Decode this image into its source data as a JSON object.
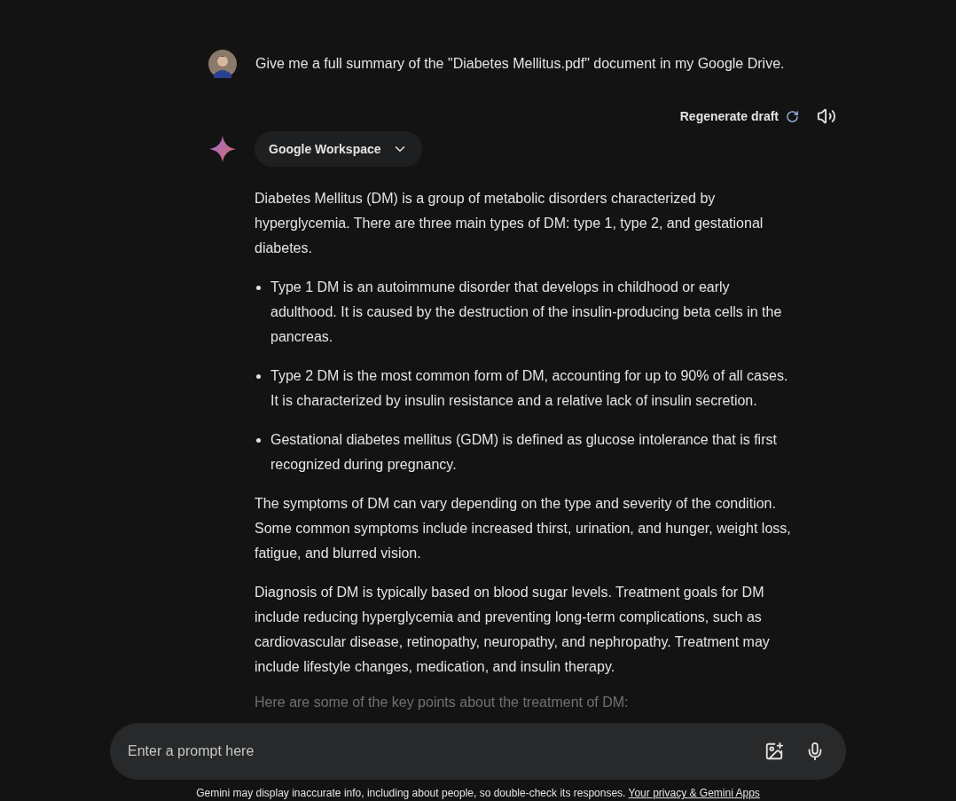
{
  "user_prompt": "Give me a full summary of the \"Diabetes Mellitus.pdf\" document in my Google Drive.",
  "regenerate_label": "Regenerate draft",
  "source_chip": "Google Workspace",
  "response": [
    {
      "kind": "paragraph",
      "text": "Diabetes Mellitus (DM) is a group of metabolic disorders characterized by hyperglycemia. There are three main types of DM: type 1, type 2, and gestational diabetes."
    },
    {
      "kind": "bullets",
      "items": [
        "Type 1 DM is an autoimmune disorder that develops in childhood or early adulthood. It is caused by the destruction of the insulin-producing beta cells in the pancreas.",
        "Type 2 DM is the most common form of DM, accounting for up to 90% of all cases. It is characterized by insulin resistance and a relative lack of insulin secretion.",
        "Gestational diabetes mellitus (GDM) is defined as glucose intolerance that is first recognized during pregnancy."
      ]
    },
    {
      "kind": "paragraph",
      "text": "The symptoms of DM can vary depending on the type and severity of the condition. Some common symptoms include increased thirst, urination, and hunger, weight loss, fatigue, and blurred vision."
    },
    {
      "kind": "paragraph",
      "text": "Diagnosis of DM is typically based on blood sugar levels. Treatment goals for DM include reducing hyperglycemia and preventing long-term complications, such as cardiovascular disease, retinopathy, neuropathy, and nephropathy. Treatment may include lifestyle changes, medication, and insulin therapy."
    },
    {
      "kind": "faded",
      "text": "Here are some of the key points about the treatment of DM:"
    }
  ],
  "prompt_field": {
    "placeholder": "Enter a prompt here"
  },
  "disclaimer": {
    "text": "Gemini may display inaccurate info, including about people, so double-check its responses.",
    "link": "Your privacy & Gemini Apps"
  }
}
